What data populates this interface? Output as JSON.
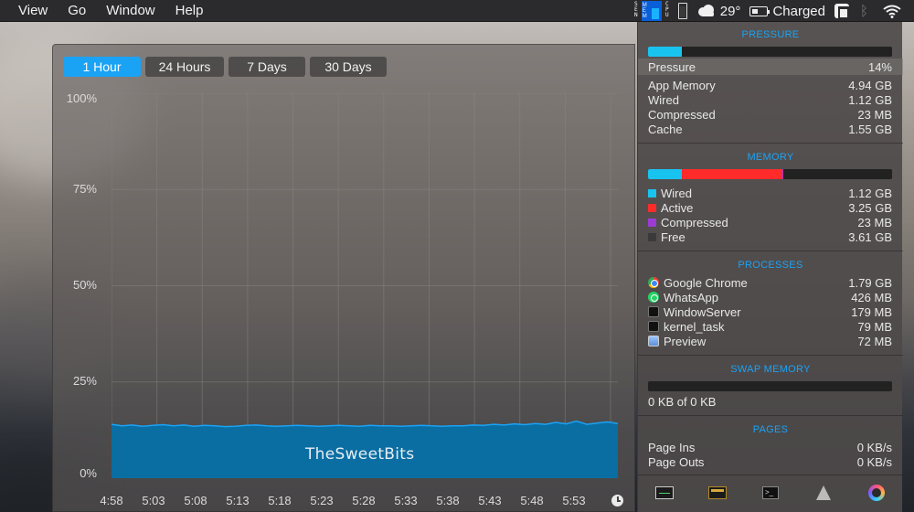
{
  "menubar": {
    "items": [
      "View",
      "Go",
      "Window",
      "Help"
    ],
    "status": {
      "sen_text": "SEN",
      "mem_text": "MEM",
      "cpu_text": "CPU",
      "temperature": "29°",
      "battery_label": "Charged",
      "icons": [
        "sensor-icon",
        "memory-icon",
        "cpu-icon",
        "battery-mini-icon",
        "cloud-icon",
        "battery-icon",
        "app-icon",
        "bluetooth-icon",
        "wifi-icon"
      ]
    }
  },
  "history": {
    "tabs": [
      "1 Hour",
      "24 Hours",
      "7 Days",
      "30 Days"
    ],
    "active_tab": "1 Hour",
    "watermark": "TheSweetBits"
  },
  "chart_data": {
    "type": "area",
    "title": "",
    "xlabel": "",
    "ylabel": "",
    "y_ticks": [
      "100%",
      "75%",
      "50%",
      "25%",
      "0%"
    ],
    "ylim": [
      0,
      100
    ],
    "x_ticks": [
      "4:58",
      "5:03",
      "5:08",
      "5:13",
      "5:18",
      "5:23",
      "5:28",
      "5:33",
      "5:38",
      "5:43",
      "5:48",
      "5:53"
    ],
    "grid": true,
    "color": "#0a6ea3",
    "line_color": "#1aa3f5",
    "series": [
      {
        "values": [
          14,
          13.6,
          13.8,
          13.5,
          13.7,
          13.9,
          13.6,
          13.8,
          13.5,
          13.7,
          13.6,
          13.4,
          13.5,
          13.7,
          13.8,
          13.6,
          13.5,
          13.6,
          13.7,
          13.6,
          13.5,
          13.6,
          13.7,
          13.6,
          13.5,
          13.7,
          13.6,
          13.6,
          13.5,
          13.6,
          13.7,
          13.6,
          13.5,
          13.6,
          13.6,
          13.8,
          13.7,
          14.0,
          13.8,
          14.1,
          13.9,
          14.2,
          14.0,
          14.5,
          14.1,
          14.8,
          14.0,
          14.3,
          14.6,
          14.2
        ]
      }
    ]
  },
  "panel": {
    "pressure": {
      "title": "PRESSURE",
      "bar_fraction": 0.14,
      "bar_color": "#19c3f0",
      "rows": [
        {
          "label": "Pressure",
          "value": "14%"
        },
        {
          "label": "App Memory",
          "value": "4.94 GB"
        },
        {
          "label": "Wired",
          "value": "1.12 GB"
        },
        {
          "label": "Compressed",
          "value": "23 MB"
        },
        {
          "label": "Cache",
          "value": "1.55 GB"
        }
      ]
    },
    "memory": {
      "title": "MEMORY",
      "segments": [
        {
          "name": "Wired",
          "fraction": 0.14,
          "color": "#19c3f0"
        },
        {
          "name": "Active",
          "fraction": 0.41,
          "color": "#ff2b2b"
        },
        {
          "name": "Compressed",
          "fraction": 0.003,
          "color": "#9b3bd4"
        },
        {
          "name": "Free",
          "fraction": 0.447,
          "color": "#222222"
        }
      ],
      "rows": [
        {
          "label": "Wired",
          "value": "1.12 GB",
          "color": "#19c3f0"
        },
        {
          "label": "Active",
          "value": "3.25 GB",
          "color": "#ff2b2b"
        },
        {
          "label": "Compressed",
          "value": "23 MB",
          "color": "#9b3bd4"
        },
        {
          "label": "Free",
          "value": "3.61 GB",
          "color": "#3a3a3a"
        }
      ]
    },
    "processes": {
      "title": "PROCESSES",
      "rows": [
        {
          "label": "Google Chrome",
          "value": "1.79 GB",
          "icon": "chrome-icon"
        },
        {
          "label": "WhatsApp",
          "value": "426 MB",
          "icon": "whatsapp-icon"
        },
        {
          "label": "WindowServer",
          "value": "179 MB",
          "icon": "terminal-icon"
        },
        {
          "label": "kernel_task",
          "value": "79 MB",
          "icon": "terminal-icon"
        },
        {
          "label": "Preview",
          "value": "72 MB",
          "icon": "preview-icon"
        }
      ]
    },
    "swap": {
      "title": "SWAP MEMORY",
      "bar_fraction": 0,
      "text": "0 KB of 0 KB"
    },
    "pages": {
      "title": "PAGES",
      "rows": [
        {
          "label": "Page Ins",
          "value": "0 KB/s"
        },
        {
          "label": "Page Outs",
          "value": "0 KB/s"
        }
      ]
    },
    "toolbar": [
      "activity-monitor-icon",
      "benchmark-icon",
      "terminal-icon",
      "rocket-icon",
      "gauge-icon"
    ]
  }
}
